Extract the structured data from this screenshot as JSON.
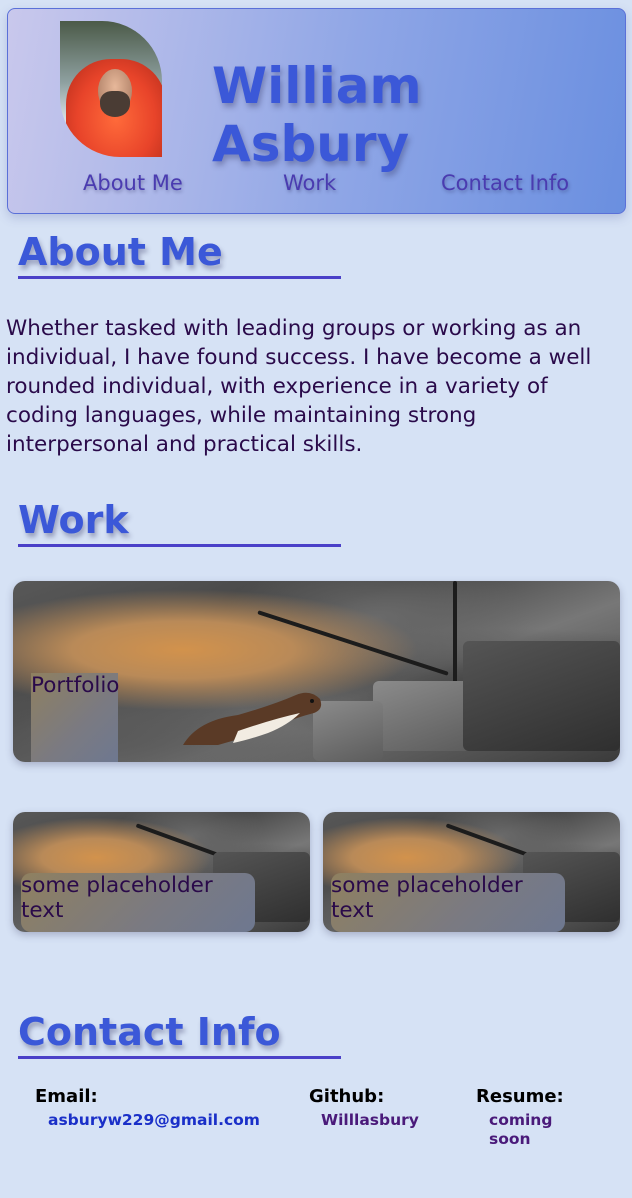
{
  "header": {
    "name": "William Asbury",
    "nav": [
      {
        "label": "About Me"
      },
      {
        "label": "Work"
      },
      {
        "label": "Contact Info"
      }
    ]
  },
  "about": {
    "heading": "About Me",
    "body": "Whether tasked with leading groups or working as an individual, I have found success. I have become a well rounded individual, with experience in a variety of coding languages, while maintaining strong interpersonal and practical skills."
  },
  "work": {
    "heading": "Work",
    "featured_label": "Portfolio",
    "cards": [
      {
        "label": "some placeholder text"
      },
      {
        "label": "some placeholder text"
      }
    ]
  },
  "contact": {
    "heading": "Contact Info",
    "email_label": "Email:",
    "email_value": "asburyw229@gmail.com",
    "github_label": "Github:",
    "github_value": "Willlasbury",
    "resume_label": "Resume:",
    "resume_value": "coming soon"
  },
  "colors": {
    "background": "#d6e2f5",
    "title_blue": "#3b58d8",
    "nav_purple": "#4a3bb0",
    "text_dark": "#2a0a4a",
    "email_blue": "#1a2fc8",
    "github_purple": "#4a1a7a"
  }
}
